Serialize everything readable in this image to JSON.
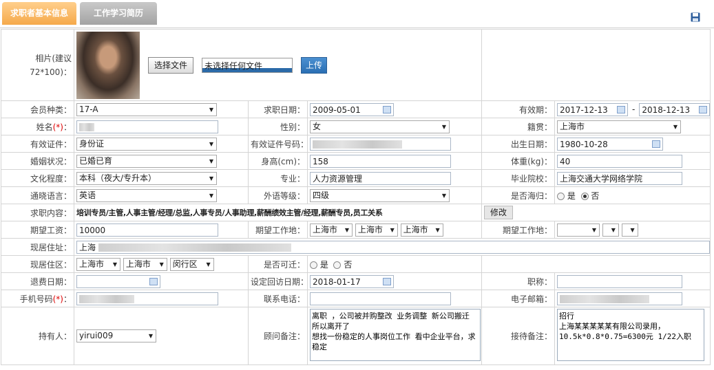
{
  "tabs": [
    "求职者基本信息",
    "工作学习简历"
  ],
  "photo": {
    "label": "相片(建议72*100)：",
    "choose_file": "选择文件",
    "no_file": "未选择任何文件",
    "upload": "上传"
  },
  "fields": {
    "member_type": {
      "label": "会员种类：",
      "value": "17-A"
    },
    "job_date": {
      "label": "求职日期：",
      "value": "2009-05-01"
    },
    "valid_period": {
      "label": "有效期：",
      "from": "2017-12-13",
      "sep": "-",
      "to": "2018-12-13"
    },
    "name": {
      "label": "姓名",
      "req": "(*)",
      "colon": "："
    },
    "gender": {
      "label": "性别：",
      "value": "女"
    },
    "native": {
      "label": "籍贯：",
      "value": "上海市"
    },
    "id_type": {
      "label": "有效证件：",
      "value": "身份证"
    },
    "id_no": {
      "label": "有效证件号码："
    },
    "birth": {
      "label": "出生日期：",
      "value": "1980-10-28"
    },
    "marriage": {
      "label": "婚姻状况：",
      "value": "已婚已育"
    },
    "height": {
      "label": "身高(cm)：",
      "value": "158"
    },
    "weight": {
      "label": "体重(kg)：",
      "value": "40"
    },
    "education": {
      "label": "文化程度：",
      "value": "本科（夜大/专升本）"
    },
    "major": {
      "label": "专业：",
      "value": "人力资源管理"
    },
    "school": {
      "label": "毕业院校：",
      "value": "上海交通大学网络学院"
    },
    "language": {
      "label": "通晓语言：",
      "value": "英语"
    },
    "foreign_level": {
      "label": "外语等级：",
      "value": "四级"
    },
    "returnee": {
      "label": "是否海归：",
      "yes": "是",
      "no": "否"
    },
    "job_content": {
      "label": "求职内容：",
      "value": "培训专员/主管,人事主管/经理/总监,人事专员/人事助理,薪酬绩效主管/经理,薪酬专员,员工关系",
      "edit": "修改"
    },
    "salary": {
      "label": "期望工资：",
      "value": "10000"
    },
    "work_place1": {
      "label": "期望工作地：",
      "v1": "上海市",
      "v2": "上海市",
      "v3": "上海市"
    },
    "work_place2": {
      "label": "期望工作地："
    },
    "address": {
      "label": "现居住址：",
      "value": "上海"
    },
    "district": {
      "label": "现居住区：",
      "v1": "上海市",
      "v2": "上海市",
      "v3": "闵行区"
    },
    "relocate": {
      "label": "是否可迁：",
      "yes": "是",
      "no": "否"
    },
    "refund_date": {
      "label": "退费日期："
    },
    "revisit_date": {
      "label": "设定回访日期：",
      "value": "2018-01-17"
    },
    "title": {
      "label": "职称："
    },
    "mobile": {
      "label": "手机号码",
      "req": "(*)",
      "colon": "："
    },
    "phone": {
      "label": "联系电话："
    },
    "email": {
      "label": "电子邮箱："
    },
    "holder": {
      "label": "持有人：",
      "value": "yirui009"
    },
    "consultant_note": {
      "label": "顾问备注：",
      "value": "离职 ，公司被并购整改 业务调整 新公司搬迁 所以离开了\n想找一份稳定的人事岗位工作 看中企业平台，求稳定"
    },
    "reception_note": {
      "label": "接待备注：",
      "value": "招行\n上海某某某某某有限公司录用，10.5k*0.8*0.75=6300元 1/22入职"
    }
  }
}
